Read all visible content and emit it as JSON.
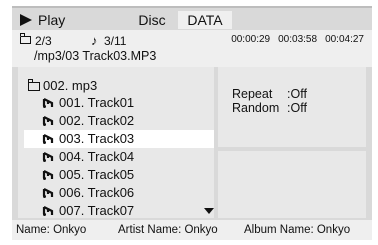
{
  "header": {
    "play_label": "Play",
    "tabs": [
      {
        "label": "Disc"
      },
      {
        "label": "DATA"
      }
    ]
  },
  "info": {
    "folder_count": "2/3",
    "track_count": "3/11",
    "time_elapsed": "00:00:29",
    "time_remaining": "00:03:58",
    "time_total": "00:04:27",
    "path": "/mp3/03 Track03.MP3"
  },
  "browser": {
    "folder": "002. mp3",
    "tracks": [
      {
        "label": "001. Track01"
      },
      {
        "label": "002. Track02"
      },
      {
        "label": "003. Track03"
      },
      {
        "label": "004. Track04"
      },
      {
        "label": "005. Track05"
      },
      {
        "label": "006. Track06"
      },
      {
        "label": "007. Track07"
      }
    ],
    "selected_index": 2
  },
  "settings": {
    "repeat_label": "Repeat",
    "repeat_value": ":Off",
    "random_label": "Random",
    "random_value": ":Off"
  },
  "footer": {
    "name": "Name: Onkyo",
    "artist": "Artist Name: Onkyo",
    "album": "Album Name: Onkyo"
  },
  "colors": {
    "frame": "#d9d9d9",
    "panel": "#e8e8e8",
    "selected_row": "#ffffff",
    "text": "#111111"
  }
}
